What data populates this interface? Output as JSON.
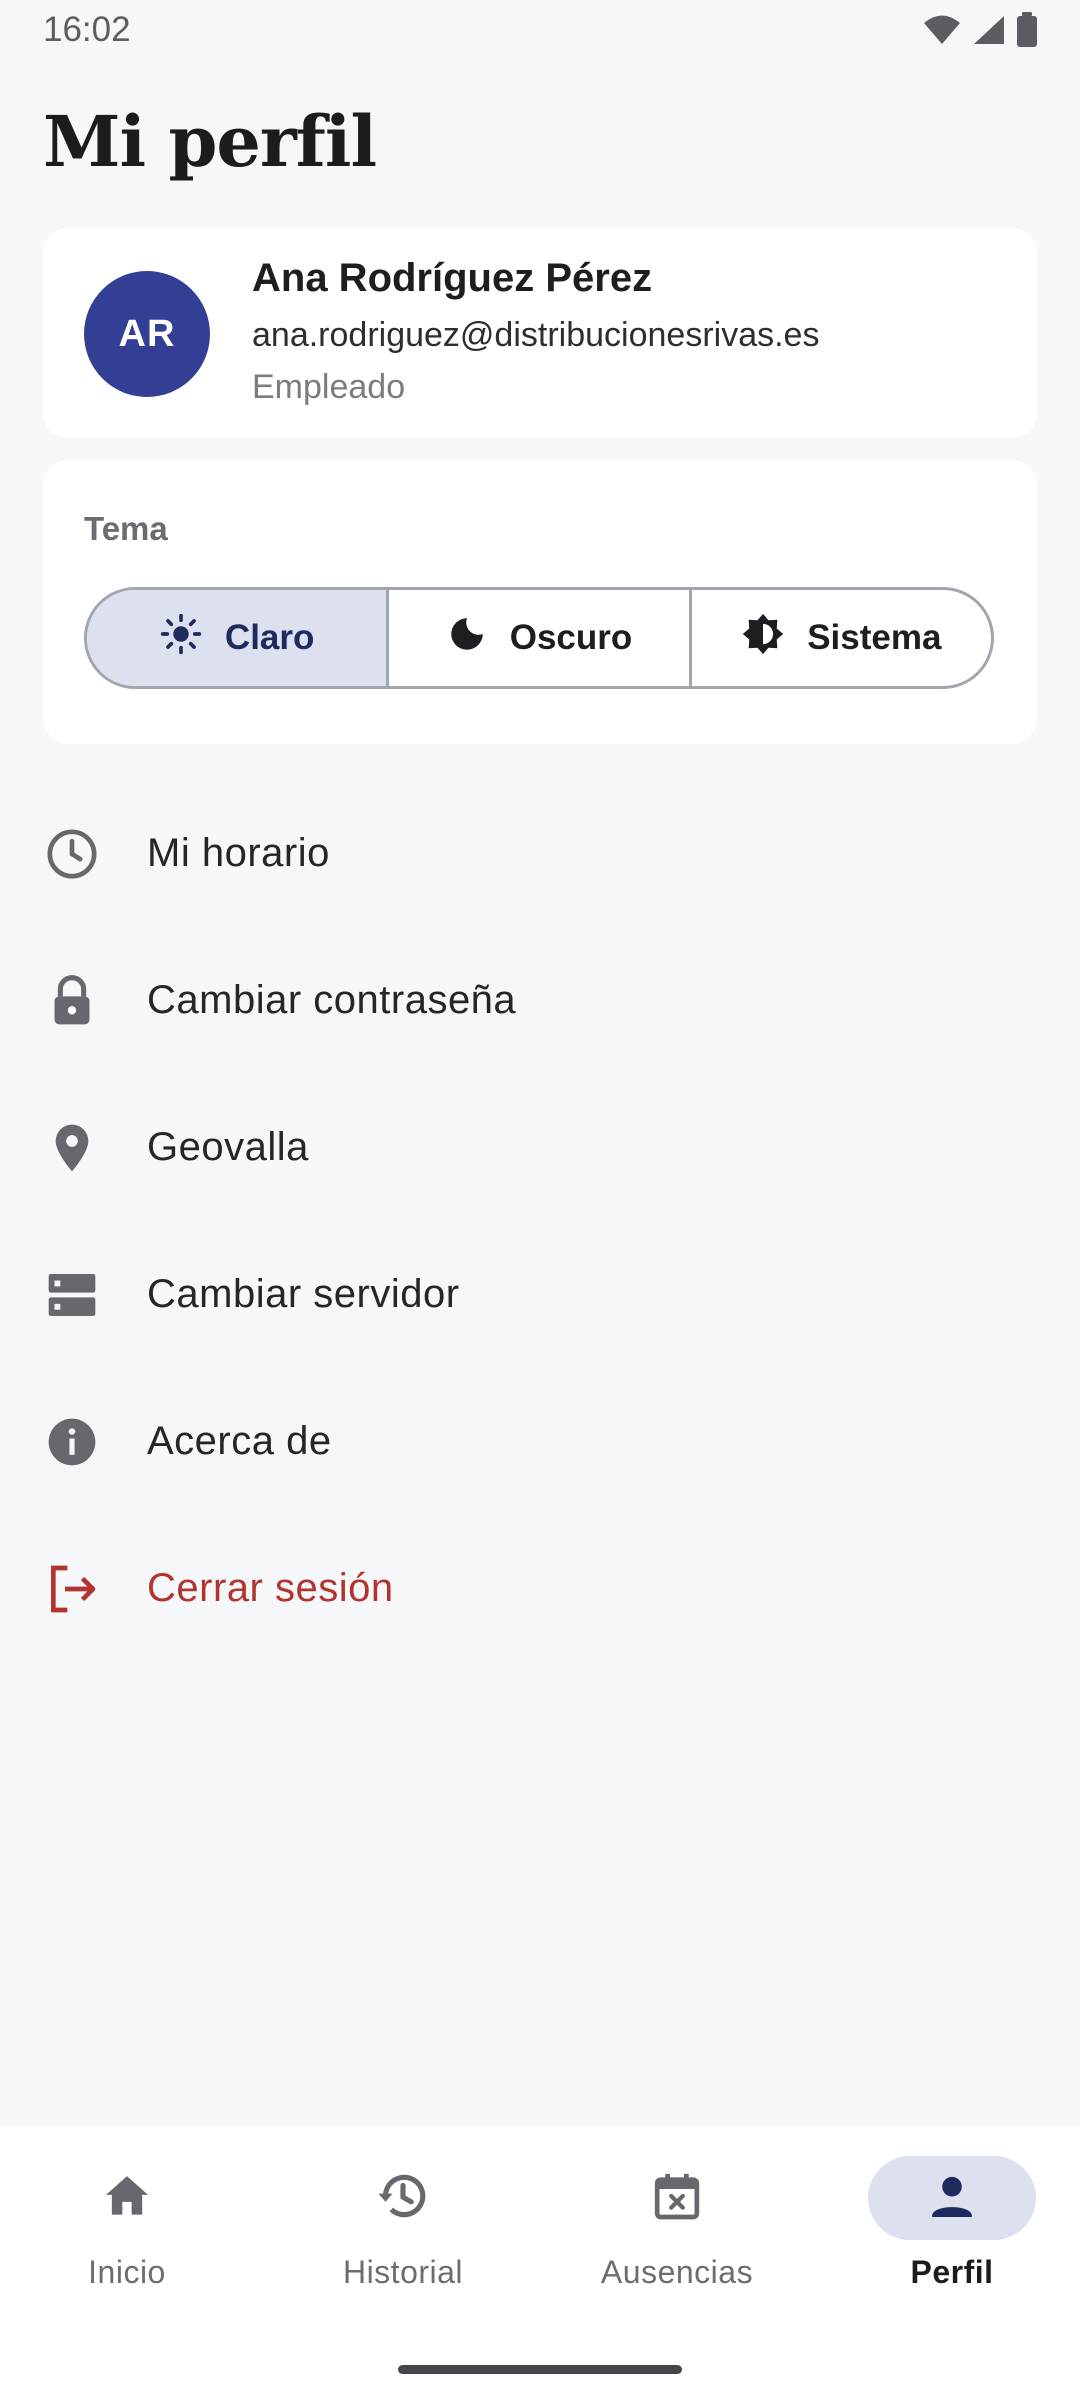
{
  "status_bar": {
    "time": "16:02",
    "icons": [
      "wifi-icon",
      "signal-icon",
      "battery-icon"
    ]
  },
  "page": {
    "title": "Mi perfil"
  },
  "profile": {
    "initials": "AR",
    "name": "Ana Rodríguez Pérez",
    "email": "ana.rodriguez@distribucionesrivas.es",
    "role": "Empleado",
    "avatar_color": "#333f94"
  },
  "theme": {
    "label": "Tema",
    "options": [
      {
        "label": "Claro",
        "icon": "sun-icon",
        "selected": true
      },
      {
        "label": "Oscuro",
        "icon": "moon-icon",
        "selected": false
      },
      {
        "label": "Sistema",
        "icon": "brightness-auto-icon",
        "selected": false
      }
    ]
  },
  "menu": {
    "items": [
      {
        "label": "Mi horario",
        "icon": "clock-icon"
      },
      {
        "label": "Cambiar contraseña",
        "icon": "lock-icon"
      },
      {
        "label": "Geovalla",
        "icon": "location-pin-icon"
      },
      {
        "label": "Cambiar servidor",
        "icon": "server-icon"
      },
      {
        "label": "Acerca de",
        "icon": "info-icon"
      },
      {
        "label": "Cerrar sesión",
        "icon": "logout-icon",
        "color": "#b3332e"
      }
    ]
  },
  "bottom_nav": {
    "items": [
      {
        "label": "Inicio",
        "icon": "home-icon",
        "active": false
      },
      {
        "label": "Historial",
        "icon": "history-icon",
        "active": false
      },
      {
        "label": "Ausencias",
        "icon": "calendar-x-icon",
        "active": false
      },
      {
        "label": "Perfil",
        "icon": "person-icon",
        "active": true
      }
    ]
  },
  "colors": {
    "background": "#f6f7f9",
    "accent": "#333f94",
    "selected_fill": "#dde0ee",
    "danger": "#b3332e"
  }
}
